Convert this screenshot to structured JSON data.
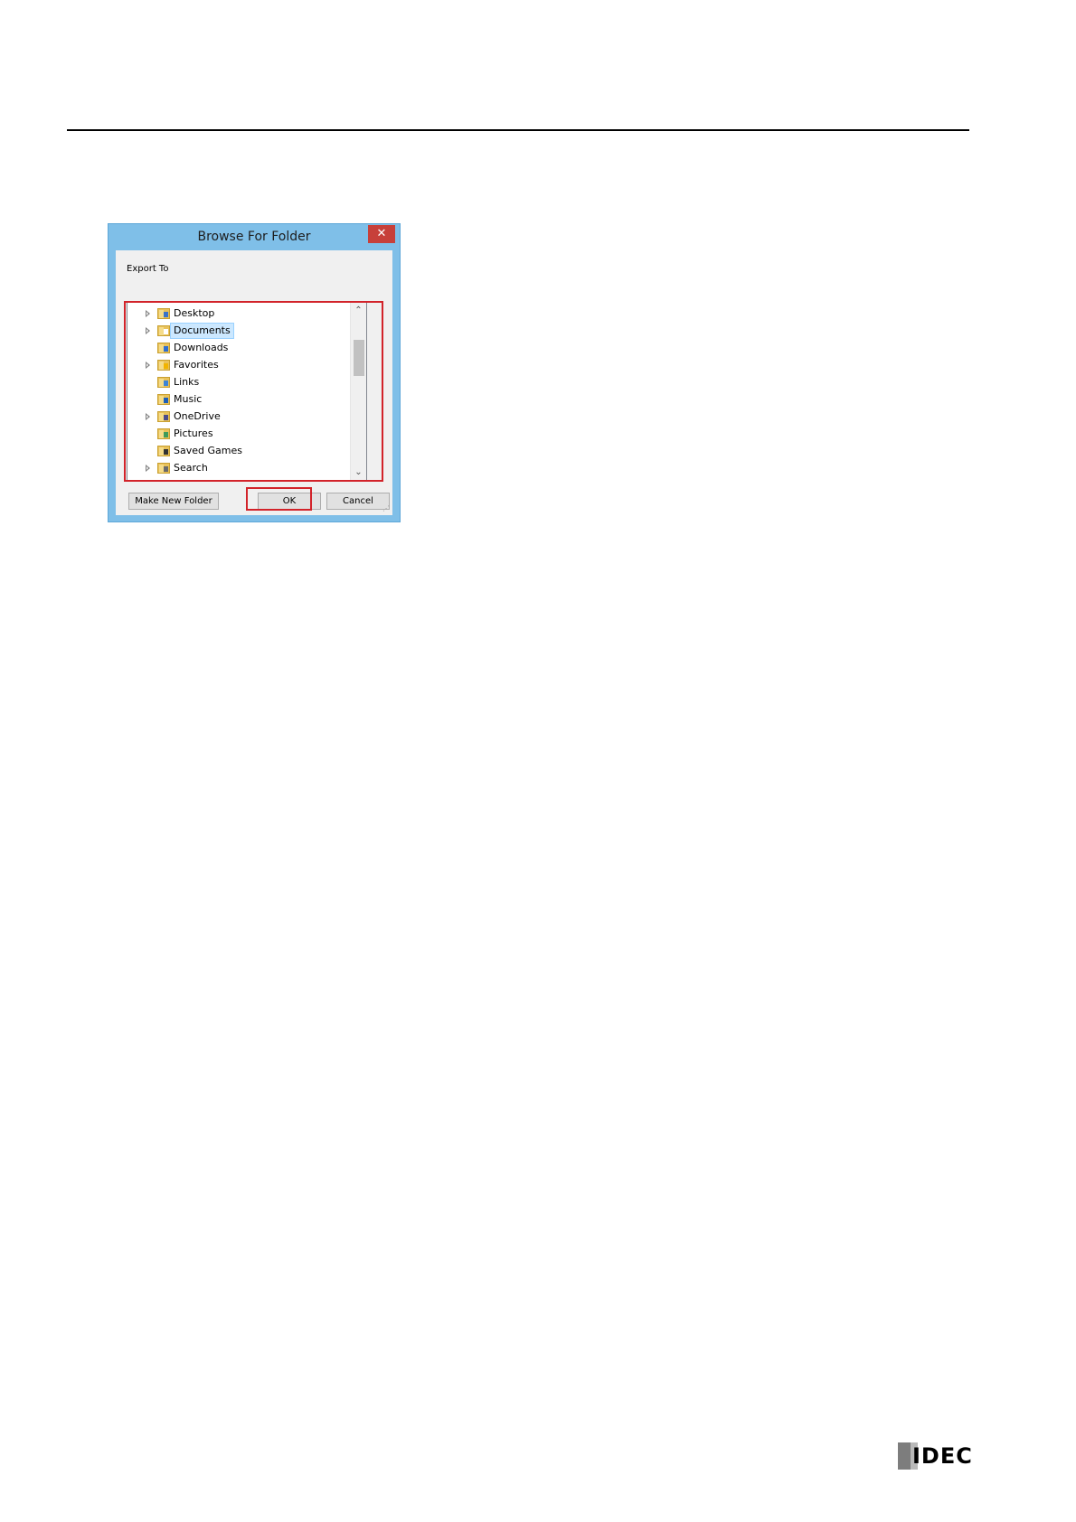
{
  "dialog": {
    "title": "Browse For Folder",
    "close_symbol": "✕",
    "description": "Export To",
    "tree_items": [
      {
        "label": "Desktop",
        "expandable": true,
        "selected": false,
        "icon": "desktop-folder-icon",
        "overlay": "#3b73c9"
      },
      {
        "label": "Documents",
        "expandable": true,
        "selected": true,
        "icon": "documents-folder-icon",
        "overlay": "#ffffff"
      },
      {
        "label": "Downloads",
        "expandable": false,
        "selected": false,
        "icon": "downloads-folder-icon",
        "overlay": "#2f6fd0"
      },
      {
        "label": "Favorites",
        "expandable": true,
        "selected": false,
        "icon": "favorites-folder-icon",
        "overlay": "#f2b400"
      },
      {
        "label": "Links",
        "expandable": false,
        "selected": false,
        "icon": "links-folder-icon",
        "overlay": "#3d84d6"
      },
      {
        "label": "Music",
        "expandable": false,
        "selected": false,
        "icon": "music-folder-icon",
        "overlay": "#1d5fb8"
      },
      {
        "label": "OneDrive",
        "expandable": true,
        "selected": false,
        "icon": "onedrive-folder-icon",
        "overlay": "#4c4c8a"
      },
      {
        "label": "Pictures",
        "expandable": false,
        "selected": false,
        "icon": "pictures-folder-icon",
        "overlay": "#3f9b5a"
      },
      {
        "label": "Saved Games",
        "expandable": false,
        "selected": false,
        "icon": "saved-games-folder-icon",
        "overlay": "#333333"
      },
      {
        "label": "Search",
        "expandable": true,
        "selected": false,
        "icon": "searches-folder-icon",
        "overlay": "#6a6a6a"
      }
    ],
    "scroll_up_symbol": "⌃",
    "scroll_down_symbol": "⌄",
    "buttons": {
      "make_new_folder": "Make New Folder",
      "ok": "OK",
      "cancel": "Cancel"
    },
    "highlight_color": "#d2232a"
  },
  "footer": {
    "logo_text": "IDEC"
  }
}
